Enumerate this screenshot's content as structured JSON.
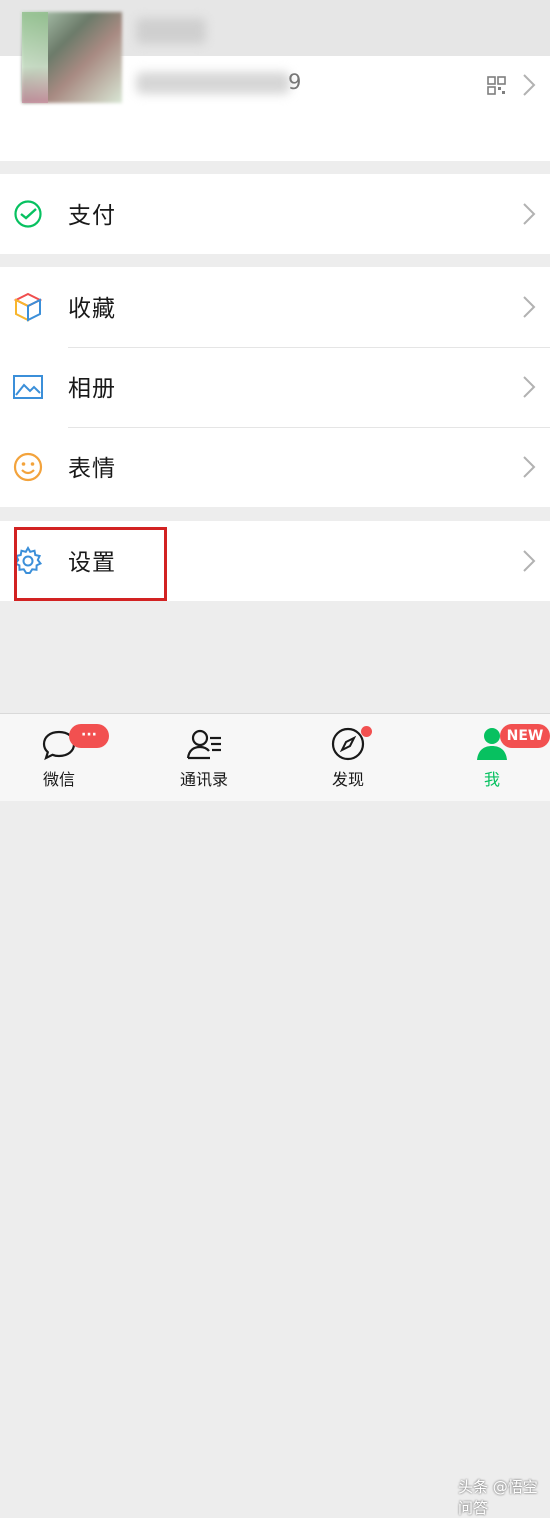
{
  "profile": {
    "wechat_id_tail": "9"
  },
  "menu": {
    "pay": "支付",
    "favorites": "收藏",
    "album": "相册",
    "stickers": "表情",
    "settings": "设置"
  },
  "tabs": {
    "chats": "微信",
    "contacts": "通讯录",
    "discover": "发现",
    "me": "我",
    "chats_badge": "···",
    "me_badge": "NEW"
  },
  "watermark": "头条 @悟空问答",
  "colors": {
    "accent_green": "#07c160",
    "badge_red": "#f25050",
    "highlight_red": "#d22222"
  }
}
